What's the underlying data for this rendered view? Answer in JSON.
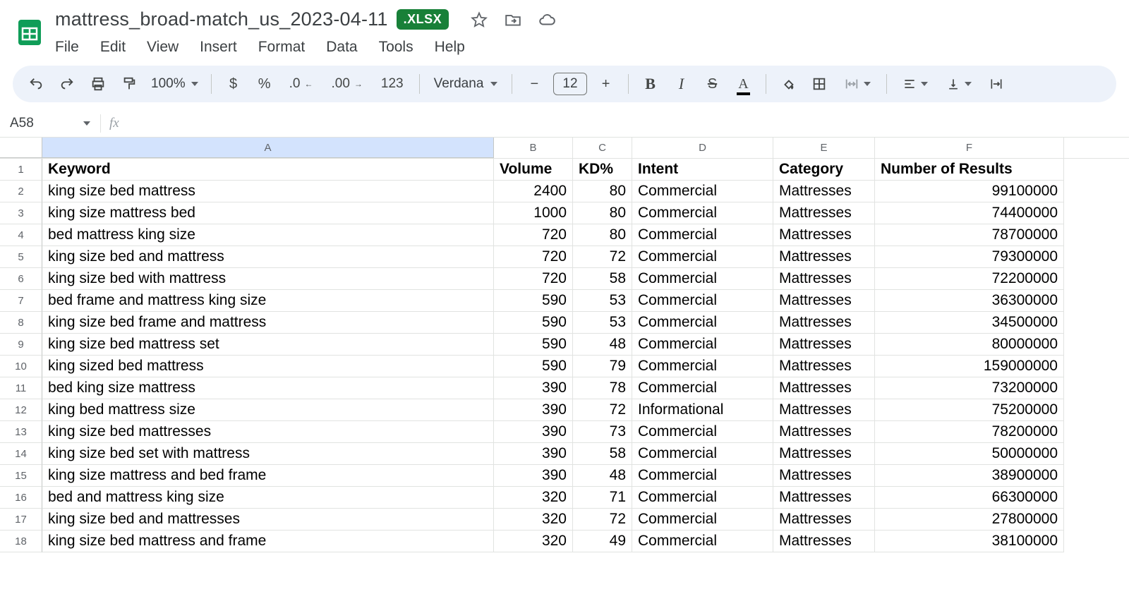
{
  "doc": {
    "title": "mattress_broad-match_us_2023-04-11",
    "badge": ".XLSX"
  },
  "menus": {
    "file": "File",
    "edit": "Edit",
    "view": "View",
    "insert": "Insert",
    "format": "Format",
    "data": "Data",
    "tools": "Tools",
    "help": "Help"
  },
  "toolbar": {
    "zoom": "100%",
    "dollar": "$",
    "percent": "%",
    "dec_dec": ".0",
    "dec_inc": ".00",
    "fmt123": "123",
    "font": "Verdana",
    "minus": "−",
    "fsize": "12",
    "plus": "+",
    "bold": "B",
    "italic": "I",
    "strike": "S",
    "textcolor": "A"
  },
  "namebox": {
    "ref": "A58",
    "fx": "fx"
  },
  "columns": {
    "A": "A",
    "B": "B",
    "C": "C",
    "D": "D",
    "E": "E",
    "F": "F"
  },
  "headers": {
    "A": "Keyword",
    "B": "Volume",
    "C": "KD%",
    "D": "Intent",
    "E": "Category",
    "F": "Number of Results"
  },
  "rows": [
    {
      "n": "1"
    },
    {
      "n": "2",
      "A": "king size bed mattress",
      "B": "2400",
      "C": "80",
      "D": "Commercial",
      "E": "Mattresses",
      "F": "99100000"
    },
    {
      "n": "3",
      "A": "king size mattress bed",
      "B": "1000",
      "C": "80",
      "D": "Commercial",
      "E": "Mattresses",
      "F": "74400000"
    },
    {
      "n": "4",
      "A": "bed mattress king size",
      "B": "720",
      "C": "80",
      "D": "Commercial",
      "E": "Mattresses",
      "F": "78700000"
    },
    {
      "n": "5",
      "A": "king size bed and mattress",
      "B": "720",
      "C": "72",
      "D": "Commercial",
      "E": "Mattresses",
      "F": "79300000"
    },
    {
      "n": "6",
      "A": "king size bed with mattress",
      "B": "720",
      "C": "58",
      "D": "Commercial",
      "E": "Mattresses",
      "F": "72200000"
    },
    {
      "n": "7",
      "A": "bed frame and mattress king size",
      "B": "590",
      "C": "53",
      "D": "Commercial",
      "E": "Mattresses",
      "F": "36300000"
    },
    {
      "n": "8",
      "A": "king size bed frame and mattress",
      "B": "590",
      "C": "53",
      "D": "Commercial",
      "E": "Mattresses",
      "F": "34500000"
    },
    {
      "n": "9",
      "A": "king size bed mattress set",
      "B": "590",
      "C": "48",
      "D": "Commercial",
      "E": "Mattresses",
      "F": "80000000"
    },
    {
      "n": "10",
      "A": "king sized bed mattress",
      "B": "590",
      "C": "79",
      "D": "Commercial",
      "E": "Mattresses",
      "F": "159000000"
    },
    {
      "n": "11",
      "A": "bed king size mattress",
      "B": "390",
      "C": "78",
      "D": "Commercial",
      "E": "Mattresses",
      "F": "73200000"
    },
    {
      "n": "12",
      "A": "king bed mattress size",
      "B": "390",
      "C": "72",
      "D": "Informational",
      "E": "Mattresses",
      "F": "75200000"
    },
    {
      "n": "13",
      "A": "king size bed mattresses",
      "B": "390",
      "C": "73",
      "D": "Commercial",
      "E": "Mattresses",
      "F": "78200000"
    },
    {
      "n": "14",
      "A": "king size bed set with mattress",
      "B": "390",
      "C": "58",
      "D": "Commercial",
      "E": "Mattresses",
      "F": "50000000"
    },
    {
      "n": "15",
      "A": "king size mattress and bed frame",
      "B": "390",
      "C": "48",
      "D": "Commercial",
      "E": "Mattresses",
      "F": "38900000"
    },
    {
      "n": "16",
      "A": "bed and mattress king size",
      "B": "320",
      "C": "71",
      "D": "Commercial",
      "E": "Mattresses",
      "F": "66300000"
    },
    {
      "n": "17",
      "A": "king size bed and mattresses",
      "B": "320",
      "C": "72",
      "D": "Commercial",
      "E": "Mattresses",
      "F": "27800000"
    },
    {
      "n": "18",
      "A": "king size bed mattress and frame",
      "B": "320",
      "C": "49",
      "D": "Commercial",
      "E": "Mattresses",
      "F": "38100000"
    }
  ]
}
